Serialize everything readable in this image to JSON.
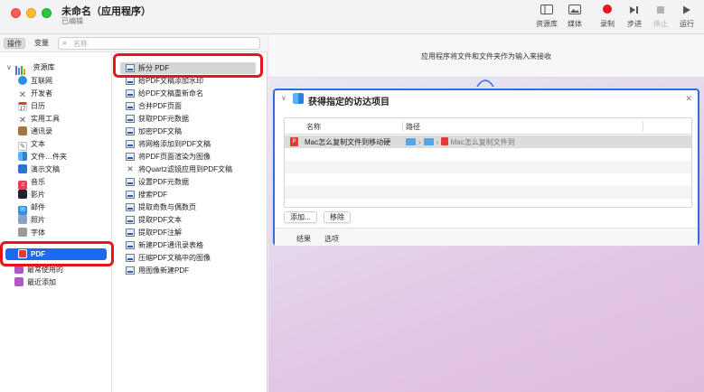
{
  "window": {
    "title": "未命名（应用程序）",
    "subtitle": "已编辑"
  },
  "toolbar": {
    "library": "资源库",
    "media": "媒体",
    "record": "录制",
    "step": "步进",
    "stop": "停止",
    "run": "运行"
  },
  "left": {
    "tab_actions": "操作",
    "tab_variables": "变量",
    "search_placeholder": "名称",
    "library_root": "资源库",
    "library_items": [
      "互联网",
      "开发者",
      "日历",
      "实用工具",
      "通讯录",
      "文本",
      "文件…件夹",
      "演示文稿",
      "音乐",
      "影片",
      "邮件",
      "照片",
      "字体",
      "PDF",
      "最常使用的",
      "最近添加"
    ],
    "actions": [
      "拆分 PDF",
      "给PDF文稿添加水印",
      "给PDF文稿重新命名",
      "合并PDF页面",
      "获取PDF元数据",
      "加密PDF文稿",
      "将网格添加到PDF文稿",
      "将PDF页面渲染为图像",
      "将Quartz滤镜应用到PDF文稿",
      "设置PDF元数据",
      "搜索PDF",
      "提取奇数与偶数页",
      "提取PDF文本",
      "提取PDF注解",
      "新建PDF通讯录表格",
      "压缩PDF文稿中的图像",
      "用图像新建PDF"
    ]
  },
  "workflow": {
    "input_hint": "应用程序将文件和文件夹作为输入来接收",
    "action_title": "获得指定的访达项目",
    "col_name": "名称",
    "col_path": "路径",
    "file_name": "Mac怎么复制文件到移动硬",
    "file_path_end": "Mac怎么复制文件到",
    "add_button": "添加...",
    "remove_button": "移除",
    "tab_results": "结果",
    "tab_options": "选项"
  },
  "colors": {
    "selection": "#1a6bf0",
    "highlight": "#e8141c",
    "card_border": "#2f6dd8"
  }
}
